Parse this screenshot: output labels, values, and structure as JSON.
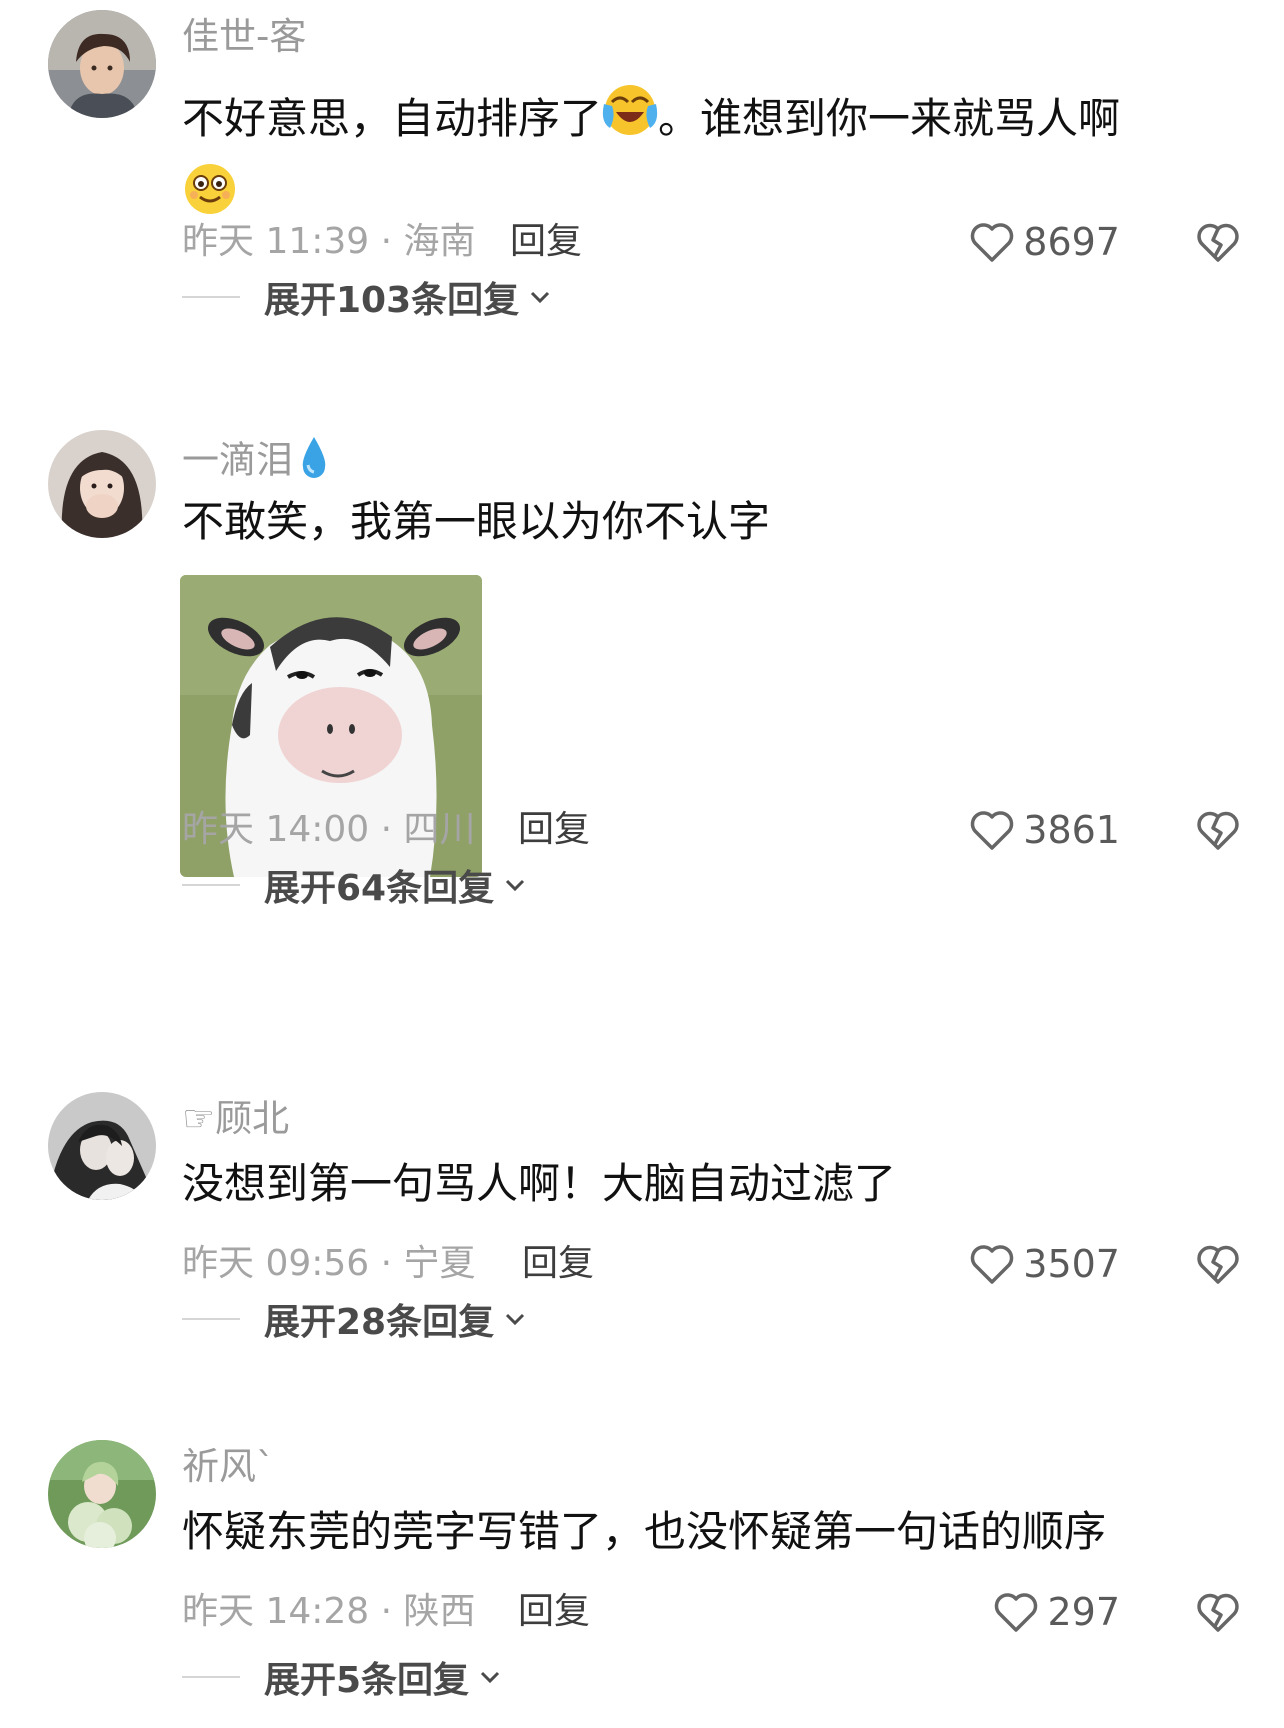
{
  "comments": [
    {
      "username": "佳世-客",
      "text_a": "不好意思，自动排序了",
      "text_b": "。谁想到你一来就骂人啊",
      "emoji_1": "laughing-crying-emoji",
      "emoji_2": "smiling-face-emoji",
      "time": "昨天 11:39 · 海南",
      "reply": "回复",
      "likes": "8697",
      "expand": "展开103条回复"
    },
    {
      "username": "一滴泪",
      "name_emoji": "droplet-emoji",
      "text": "不敢笑，我第一眼以为你不认字",
      "sticker": "cow-sticker-image",
      "time": "昨天 14:00 · 四川",
      "reply": "回复",
      "likes": "3861",
      "expand": "展开64条回复"
    },
    {
      "username": "☞顾北",
      "text": "没想到第一句骂人啊！大脑自动过滤了",
      "time": "昨天 09:56 · 宁夏",
      "reply": "回复",
      "likes": "3507",
      "expand": "展开28条回复"
    },
    {
      "username": "祈风`",
      "text": "怀疑东莞的莞字写错了，也没怀疑第一句话的顺序",
      "time": "昨天 14:28 · 陕西",
      "reply": "回复",
      "likes": "297",
      "expand": "展开5条回复"
    }
  ],
  "icons": {
    "like": "heart-outline-icon",
    "dislike": "broken-heart-icon",
    "expand": "chevron-down-icon"
  },
  "colors": {
    "username": "#9a9a9a",
    "meta": "#a5a5a5",
    "body": "#111111"
  }
}
